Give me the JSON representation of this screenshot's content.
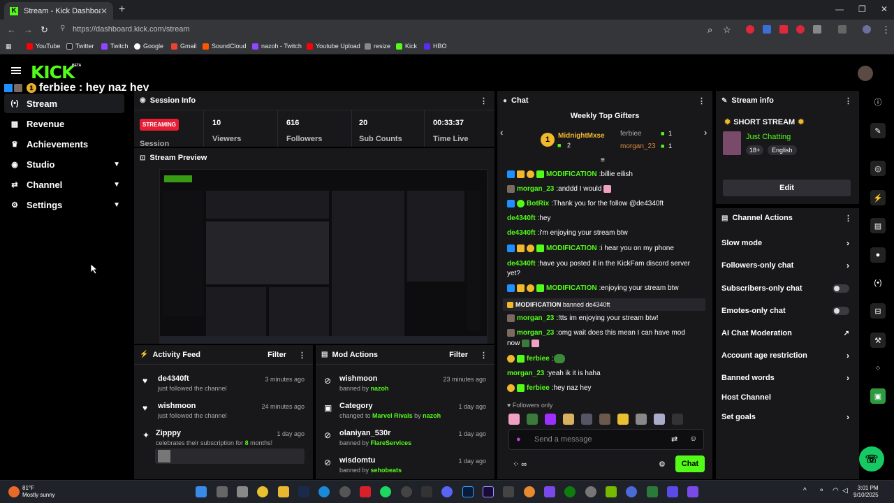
{
  "browser": {
    "tab_title": "Stream - Kick Dashboard",
    "url": "https://dashboard.kick.com/stream",
    "bookmarks": [
      "YouTube",
      "Twitter",
      "Twitch",
      "Google",
      "Gmail",
      "SoundCloud",
      "nazoh - Twitch",
      "Youtube Upload",
      "resize",
      "Kick",
      "HBO"
    ]
  },
  "header": {
    "logo": "KICK",
    "beta": "BETA",
    "overlay_user": "ferbiee",
    "overlay_text": "ferbiee : hey naz hey",
    "overlay_badge": "1"
  },
  "nav": [
    {
      "label": "Stream",
      "icon": "broadcast-icon",
      "glyph": "(•)",
      "active": true
    },
    {
      "label": "Revenue",
      "icon": "chart-icon",
      "glyph": "▦"
    },
    {
      "label": "Achievements",
      "icon": "trophy-icon",
      "glyph": "♛"
    },
    {
      "label": "Studio",
      "icon": "studio-icon",
      "glyph": "◉",
      "expandable": true
    },
    {
      "label": "Channel",
      "icon": "channel-icon",
      "glyph": "⇄",
      "expandable": true
    },
    {
      "label": "Settings",
      "icon": "gear-icon",
      "glyph": "⚙",
      "expandable": true
    }
  ],
  "session": {
    "title": "Session Info",
    "status": "STREAMING",
    "label": "Session",
    "stats": [
      {
        "value": "10",
        "label": "Viewers"
      },
      {
        "value": "616",
        "label": "Followers"
      },
      {
        "value": "20",
        "label": "Sub Counts"
      },
      {
        "value": "00:33:37",
        "label": "Time Live"
      }
    ]
  },
  "preview": {
    "title": "Stream Preview"
  },
  "activity": {
    "title": "Activity Feed",
    "filter": "Filter",
    "items": [
      {
        "name": "de4340ft",
        "sub": "just followed the channel",
        "time": "3 minutes ago",
        "icon": "heart-icon"
      },
      {
        "name": "wishmoon",
        "sub": "just followed the channel",
        "time": "24 minutes ago",
        "icon": "heart-icon"
      },
      {
        "name": "Zipppy",
        "sub_pre": "celebrates their subscription for ",
        "sub_hl": "8",
        "sub_post": " months!",
        "time": "1 day ago",
        "icon": "star-icon"
      }
    ]
  },
  "mod": {
    "title": "Mod Actions",
    "filter": "Filter",
    "items": [
      {
        "name": "wishmoon",
        "sub_pre": "banned by ",
        "sub_hl": "nazoh",
        "time": "23 minutes ago",
        "icon": "ban-icon"
      },
      {
        "name": "Category",
        "sub_pre": "changed to ",
        "sub_hl": "Marvel Rivals",
        "sub_mid": " by ",
        "sub_hl2": "nazoh",
        "time": "1 day ago",
        "icon": "category-icon"
      },
      {
        "name": "olaniyan_530r",
        "sub_pre": "banned by ",
        "sub_hl": "FlareServices",
        "time": "1 day ago",
        "icon": "ban-icon"
      },
      {
        "name": "wisdomtu",
        "sub_pre": "banned by ",
        "sub_hl": "sehobeats",
        "time": "1 day ago",
        "icon": "ban-icon"
      }
    ]
  },
  "chat": {
    "title": "Chat",
    "gifters_title": "Weekly Top Gifters",
    "gifters": [
      {
        "name": "MidnightMxse",
        "count": "2",
        "rank": "1"
      },
      {
        "name": "ferbiee",
        "count": "1"
      },
      {
        "name": "morgan_23",
        "count": "1"
      }
    ],
    "messages": [
      {
        "user": "MODIFICATION",
        "text": "billie eilish",
        "color": "#53fc18"
      },
      {
        "user": "morgan_23",
        "text": "anddd I would",
        "color": "#53fc18"
      },
      {
        "user": "BotRix",
        "text": "Thank you for the follow @de4340ft",
        "color": "#53fc18"
      },
      {
        "user": "de4340ft",
        "text": "hey",
        "color": "#53fc18"
      },
      {
        "user": "de4340ft",
        "text": "i'm enjoying your stream btw",
        "color": "#53fc18"
      },
      {
        "user": "MODIFICATION",
        "text": "i hear you on my phone",
        "color": "#53fc18"
      },
      {
        "user": "de4340ft",
        "text": "have you posted it in the KickFam discord server",
        "color": "#53fc18"
      },
      {
        "user": "",
        "text": "yet?",
        "color": "#fff"
      },
      {
        "user": "MODIFICATION",
        "text": "enjoying your stream btw",
        "color": "#53fc18"
      },
      {
        "user": "MODIFICATION",
        "text": "banned de4340ft",
        "color": "#fff",
        "system": true
      },
      {
        "user": "morgan_23",
        "text": "!tts im enjoying your stream btw!",
        "color": "#53fc18"
      },
      {
        "user": "morgan_23",
        "text": "omg wait does this mean I can have mod",
        "color": "#53fc18"
      },
      {
        "user": "",
        "text": "now",
        "color": "#fff"
      },
      {
        "user": "ferbiee",
        "text": "",
        "color": "#53fc18"
      },
      {
        "user": "morgan_23",
        "text": "yeah ik it is haha",
        "color": "#53fc18"
      },
      {
        "user": "ferbiee",
        "text": "hey naz hey",
        "color": "#53fc18"
      }
    ],
    "followers_only": "Followers only",
    "placeholder": "Send a message",
    "send": "Chat"
  },
  "stream_info": {
    "title": "Stream info",
    "stream_title": "SHORT STREAM",
    "category": "Just Chatting",
    "tags": [
      "18+",
      "English"
    ],
    "edit": "Edit"
  },
  "channel_actions": {
    "title": "Channel Actions",
    "items": [
      {
        "label": "Slow mode",
        "control": "arrow"
      },
      {
        "label": "Followers-only chat",
        "control": "arrow"
      },
      {
        "label": "Subscribers-only chat",
        "control": "toggle"
      },
      {
        "label": "Emotes-only chat",
        "control": "toggle"
      },
      {
        "label": "AI Chat Moderation",
        "control": "external"
      },
      {
        "label": "Account age restriction",
        "control": "arrow"
      },
      {
        "label": "Banned words",
        "control": "arrow"
      },
      {
        "label": "Host Channel",
        "control": "none"
      },
      {
        "label": "Set goals",
        "control": "arrow"
      }
    ]
  },
  "taskbar": {
    "temp": "81°F",
    "weather": "Mostly sunny",
    "time": "3:01 PM",
    "date": "9/10/2025"
  },
  "colors": {
    "accent": "#53fc18",
    "streaming": "#e61e35",
    "panel": "#18181b"
  }
}
